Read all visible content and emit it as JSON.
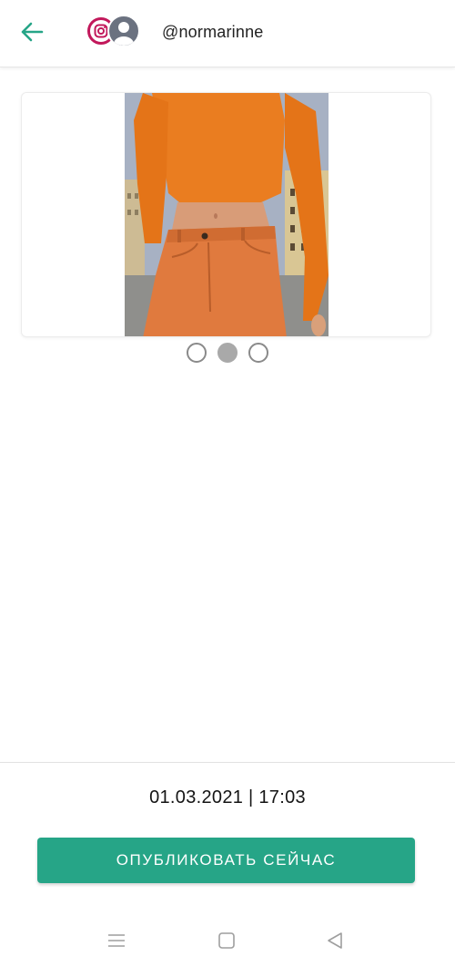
{
  "header": {
    "back_icon": "arrow-left-icon",
    "network_icon": "instagram-icon",
    "avatar_icon": "person-icon",
    "username": "@normarinne"
  },
  "media": {
    "image_subject": "orange-outfit-photo",
    "page_count": 3,
    "current_page": 2
  },
  "footer": {
    "datetime": "01.03.2021 | 17:03",
    "publish_label": "ОПУБЛИКОВАТЬ СЕЙЧАС"
  },
  "system_nav": {
    "menu_icon": "menu-icon",
    "home_icon": "square-home-icon",
    "back_icon": "triangle-back-icon"
  },
  "colors": {
    "accent": "#26a587",
    "instagram": "#c2185b",
    "back_arrow": "#26a587"
  }
}
